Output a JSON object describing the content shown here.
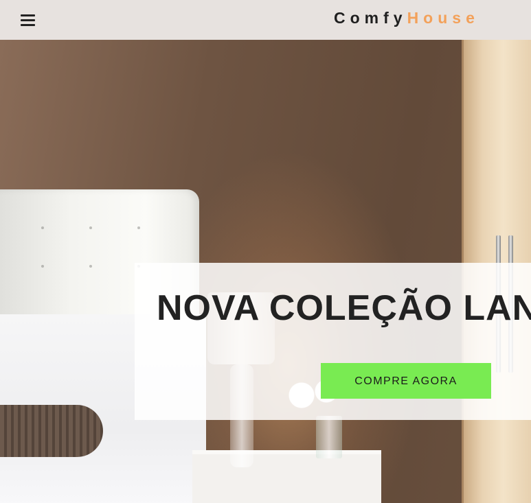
{
  "navbar": {
    "menu_icon": "hamburger-menu-icon",
    "brand_part1": "Comfy",
    "brand_part2": "House",
    "colors": {
      "background": "#e7e2df",
      "brand_dark": "#1f1f1f",
      "brand_accent": "#f3a15a"
    }
  },
  "hero": {
    "image": "bedroom-hero-image",
    "banner": {
      "title": "NOVA COLEÇÃO LANÇADA",
      "button_label": "COMPRE AGORA",
      "button_color": "#79eb52"
    }
  }
}
